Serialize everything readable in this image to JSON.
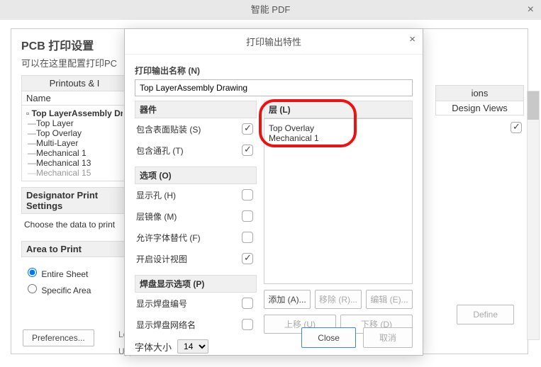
{
  "window": {
    "title": "智能 PDF",
    "close": "×"
  },
  "pcb": {
    "title": "PCB 打印设置",
    "subtitle": "可以在这里配置打印PC"
  },
  "printouts_head": "Printouts & I",
  "name_col": "Name",
  "tree": {
    "root": "Top LayerAssembly Dra",
    "children": [
      "Top Layer",
      "Top Overlay",
      "Multi-Layer",
      "Mechanical 1",
      "Mechanical 13",
      "Mechanical 15"
    ]
  },
  "designator_head": "Designator Print Settings",
  "designator_text": "Choose the data to print",
  "area": {
    "head": "Area to Print",
    "entire": "Entire Sheet",
    "specific": "Specific Area",
    "lower": "Lowe",
    "upper": "Uppe"
  },
  "preferences": "Preferences...",
  "design_views": {
    "head": "ions",
    "label": "Design Views"
  },
  "define": "Define",
  "modal": {
    "title": "打印输出特性",
    "close": "×",
    "outname_label": "打印输出名称 (N)",
    "outname_value": "Top LayerAssembly Drawing",
    "group_qijian": "器件",
    "opt_smd": "包含表面贴装 (S)",
    "opt_th": "包含通孔 (T)",
    "group_options": "选项 (O)",
    "opt_holes": "显示孔 (H)",
    "opt_mirror": "层镜像 (M)",
    "opt_font": "允许字体替代 (F)",
    "opt_design": "开启设计视图",
    "group_pad": "焊盘显示选项 (P)",
    "opt_padnum": "显示焊盘编号",
    "opt_padnet": "显示焊盘网络名",
    "font_label": "字体大小",
    "font_value": "14",
    "group_layer": "层 (L)",
    "layers": [
      "Top Overlay",
      "Mechanical 1"
    ],
    "btn_add": "添加 (A)...",
    "btn_remove": "移除 (R)...",
    "btn_edit": "编辑 (E)...",
    "btn_up": "上移 (U)",
    "btn_down": "下移 (D)",
    "btn_close": "Close",
    "btn_cancel": "取消"
  }
}
